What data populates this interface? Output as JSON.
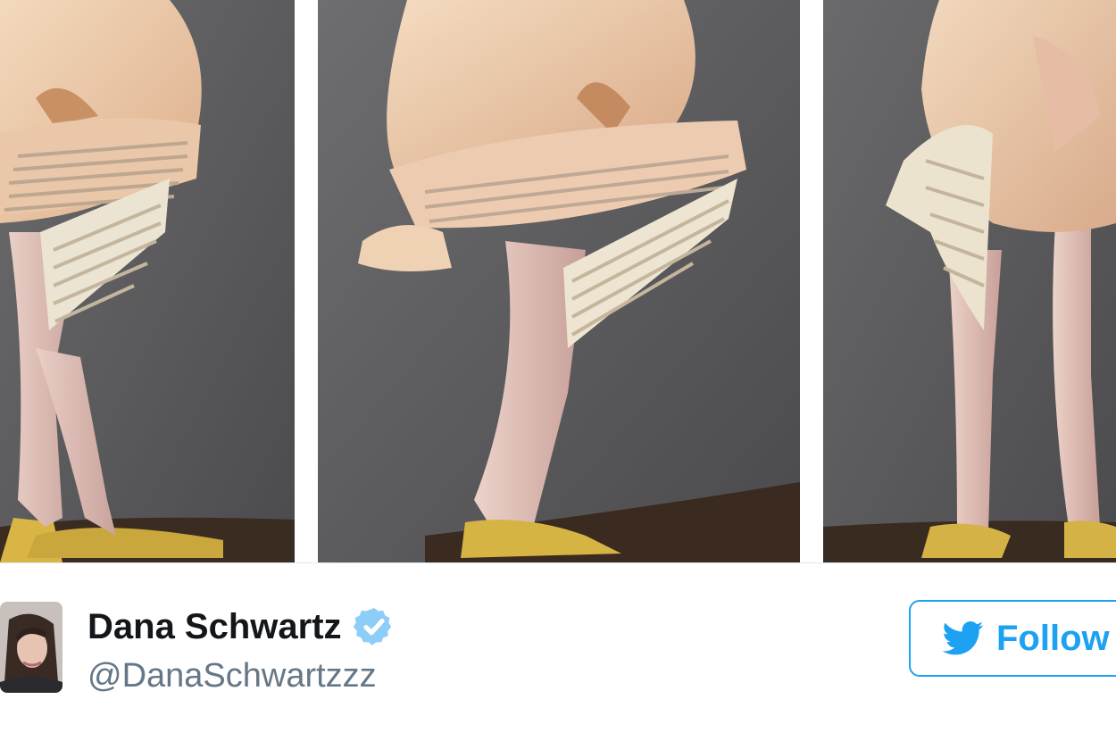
{
  "tweet": {
    "media": {
      "photos": [
        {
          "name": "plucked-bird-photo-1"
        },
        {
          "name": "plucked-bird-photo-2"
        },
        {
          "name": "plucked-bird-photo-3"
        }
      ]
    },
    "author": {
      "display_name": "Dana Schwartz",
      "handle": "@DanaSchwartzzz",
      "verified": true
    },
    "follow_button": {
      "label": "Follow"
    }
  },
  "colors": {
    "twitter_blue": "#1da1f2",
    "name_text": "#14171a",
    "handle_text": "#657786",
    "verified_badge": "#8ecdf8"
  },
  "icons": [
    "verified-badge-icon",
    "twitter-bird-icon"
  ]
}
